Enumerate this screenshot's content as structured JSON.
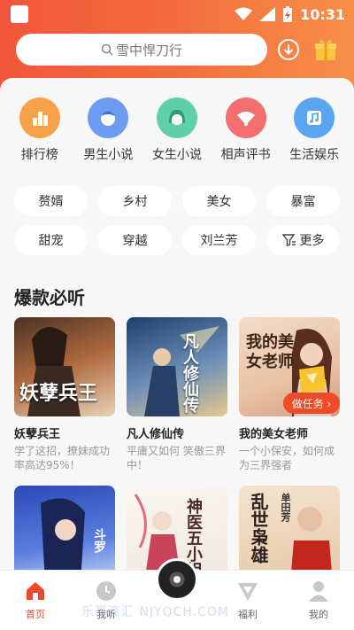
{
  "status": {
    "time": "10:31"
  },
  "search": {
    "placeholder": "雪中悍刀行"
  },
  "categories": [
    {
      "label": "排行榜",
      "icon": "ranking-icon",
      "color": "#f7a24a"
    },
    {
      "label": "男生小说",
      "icon": "male-avatar-icon",
      "color": "#6c9cf2"
    },
    {
      "label": "女生小说",
      "icon": "female-avatar-icon",
      "color": "#5ecfa7"
    },
    {
      "label": "相声评书",
      "icon": "fan-icon",
      "color": "#f26f6f"
    },
    {
      "label": "生活娱乐",
      "icon": "music-note-icon",
      "color": "#5aa5f0"
    }
  ],
  "tags": [
    "赘婿",
    "乡村",
    "美女",
    "暴富",
    "甜宠",
    "穿越",
    "刘兰芳",
    "更多"
  ],
  "section": {
    "title": "爆款必听"
  },
  "books": [
    {
      "title": "妖孽兵王",
      "desc": "学了这招，撩妹成功率高达95%！",
      "cover_text": "妖孽兵王"
    },
    {
      "title": "凡人修仙传",
      "desc": "平庸又如何 笑傲三界中！",
      "cover_text": "凡人修仙传"
    },
    {
      "title": "我的美女老师",
      "desc": "一个小保安，如何成为三界强者",
      "cover_text": "我的美女老师"
    }
  ],
  "books_row2": [
    {
      "cover_text": "斗罗"
    },
    {
      "cover_text": "神医五小姐"
    },
    {
      "cover_text": "乱世枭雄",
      "author": "单田芳"
    }
  ],
  "task": {
    "label": "做任务 ›"
  },
  "tabs": [
    {
      "label": "首页",
      "icon": "home-icon",
      "active": true
    },
    {
      "label": "我听",
      "icon": "clock-icon",
      "active": false
    },
    {
      "label": "",
      "icon": "disc-icon",
      "active": false
    },
    {
      "label": "福利",
      "icon": "welfare-icon",
      "active": false
    },
    {
      "label": "我的",
      "icon": "profile-icon",
      "active": false
    }
  ],
  "watermark": "乐哥资汇 NJYQCH.COM",
  "colors": {
    "accent": "#ec4a2a",
    "header_start": "#f2553a",
    "header_end": "#f68f48"
  }
}
